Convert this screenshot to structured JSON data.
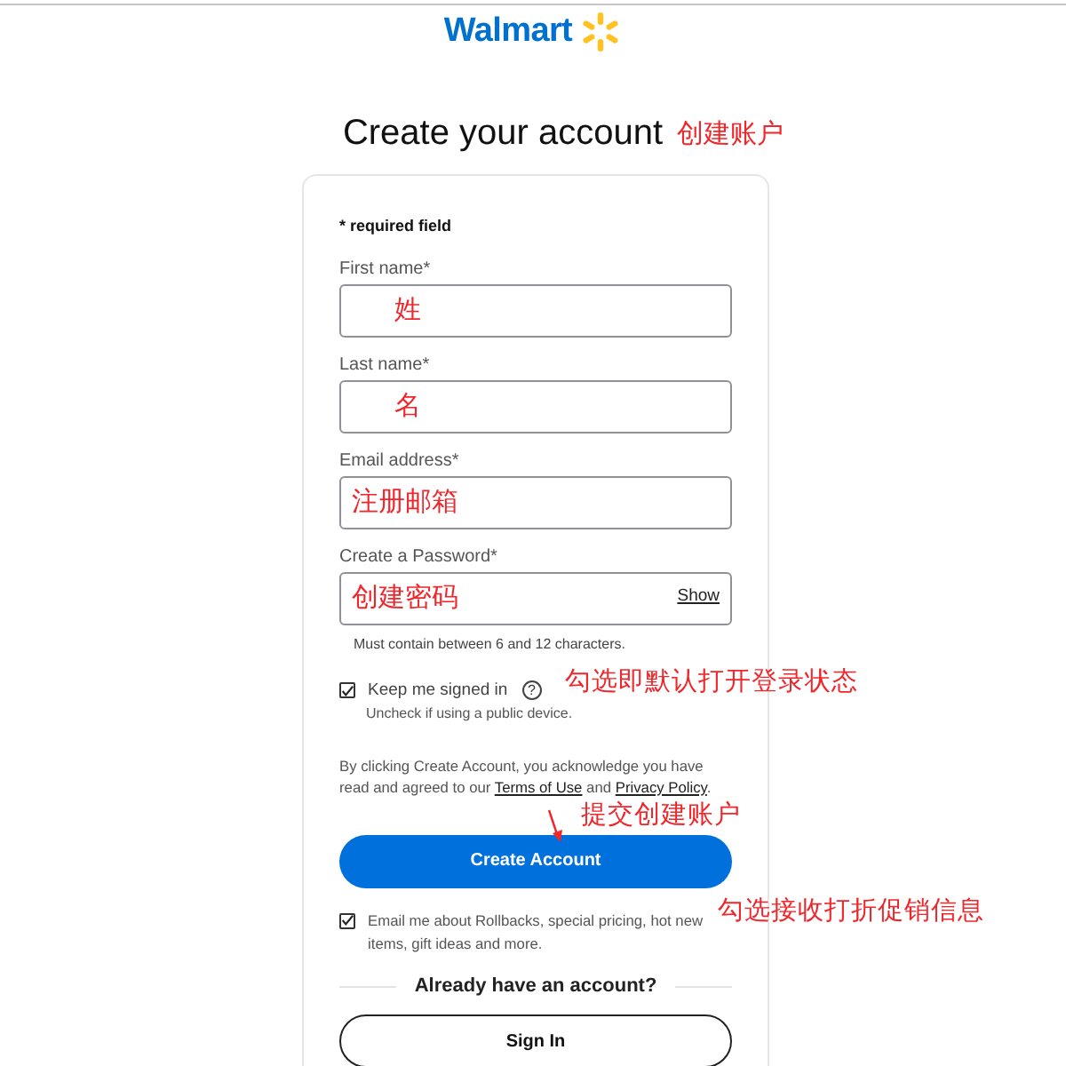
{
  "logo": {
    "text": "Walmart"
  },
  "title": {
    "text": "Create your account",
    "note": "创建账户"
  },
  "required_note": "* required field",
  "fields": [
    {
      "label": "First name*",
      "value": "姓",
      "indented": true
    },
    {
      "label": "Last name*",
      "value": "名",
      "indented": true
    },
    {
      "label": "Email address*",
      "value": "注册邮箱",
      "indented": false
    },
    {
      "label": "Create a Password*",
      "value": "创建密码",
      "indented": false,
      "action": "Show",
      "hint": "Must contain between 6 and 12 characters."
    }
  ],
  "keep_signed_in": {
    "label": "Keep me signed in",
    "help": "?",
    "hint": "Uncheck if using a public device.",
    "checked": true,
    "note": "勾选即默认打开登录状态"
  },
  "terms": {
    "parts": [
      {
        "kind": "text",
        "text": "By clicking Create Account, you acknowledge you have read and agreed to our "
      },
      {
        "kind": "link",
        "text": "Terms of Use"
      },
      {
        "kind": "text",
        "text": " and "
      },
      {
        "kind": "link",
        "text": "Privacy Policy"
      },
      {
        "kind": "text",
        "text": "."
      }
    ],
    "note": "提交创建账户"
  },
  "create_button": "Create Account",
  "email_opt_in": {
    "label": "Email me about Rollbacks, special pricing, hot new items, gift ideas and more.",
    "checked": true,
    "note": "勾选接收打折促销信息"
  },
  "divider_text": "Already have an account?",
  "sign_in_button": "Sign In"
}
